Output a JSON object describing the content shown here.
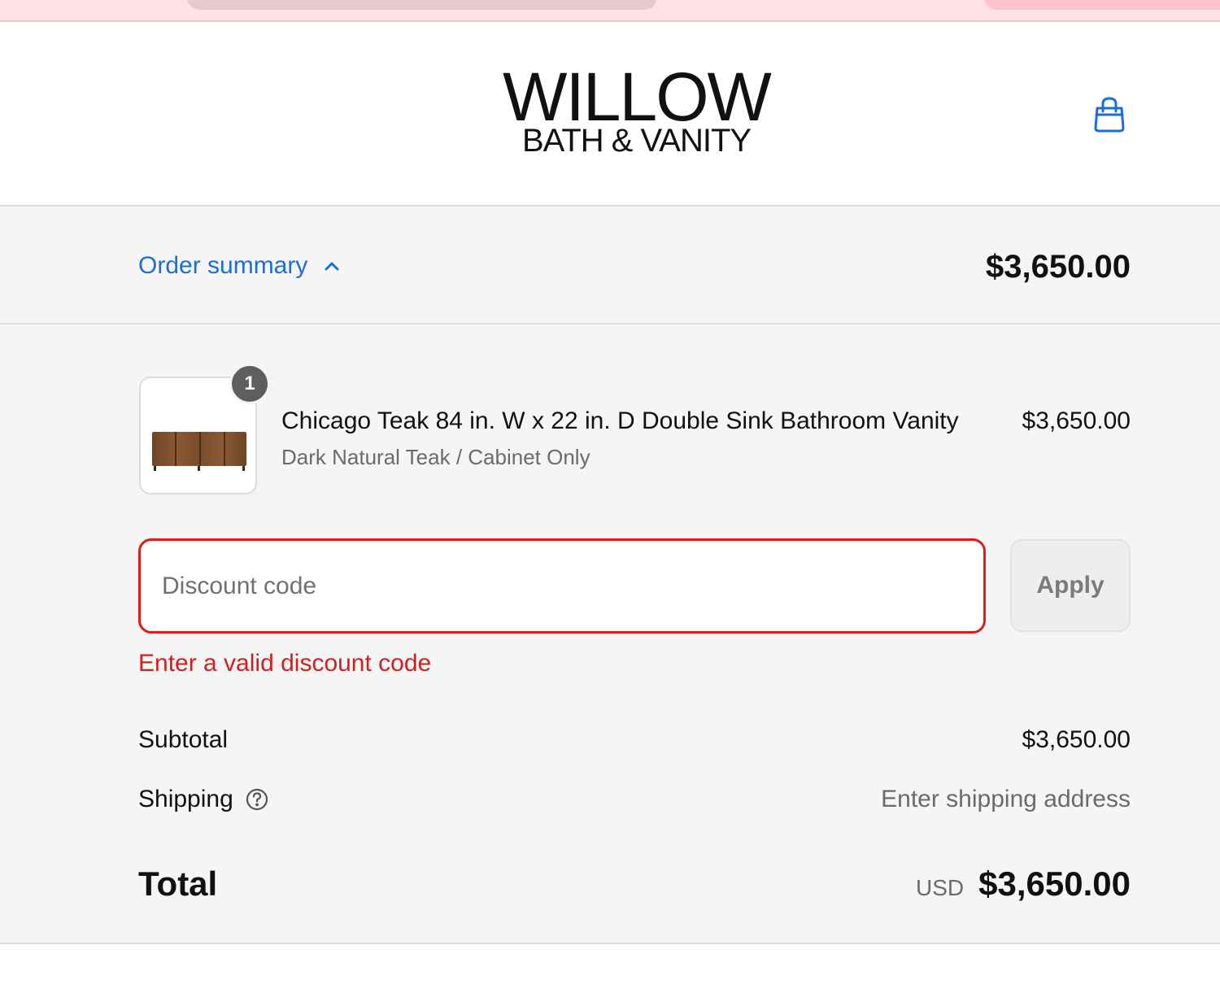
{
  "brand": {
    "logo_line1": "WILLOW",
    "logo_line2": "BATH & VANITY",
    "accent_color": "#1a6ed8",
    "error_color": "#d01f1f"
  },
  "header": {
    "cart_icon": "shopping-bag-icon"
  },
  "summary": {
    "toggle_label": "Order summary",
    "toggle_icon": "chevron-up-icon",
    "total": "$3,650.00"
  },
  "items": [
    {
      "quantity": "1",
      "name": "Chicago Teak 84 in. W x 22 in. D Double Sink Bathroom Vanity",
      "variant": "Dark Natural Teak / Cabinet Only",
      "price": "$3,650.00"
    }
  ],
  "discount": {
    "placeholder": "Discount code",
    "value": "",
    "apply_label": "Apply",
    "error": "Enter a valid discount code"
  },
  "totals": {
    "subtotal_label": "Subtotal",
    "subtotal_value": "$3,650.00",
    "shipping_label": "Shipping",
    "shipping_help_icon": "help-circle-icon",
    "shipping_value": "Enter shipping address",
    "total_label": "Total",
    "currency": "USD",
    "total_value": "$3,650.00"
  }
}
